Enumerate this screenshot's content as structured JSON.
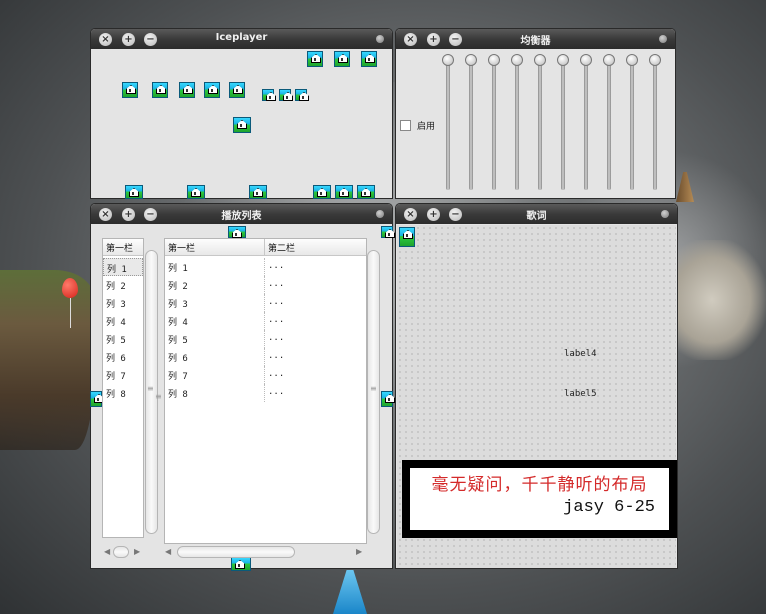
{
  "windows": {
    "player": {
      "title": "Iceplayer",
      "buttons": {
        "close": "×",
        "add": "+",
        "minimize": "−"
      }
    },
    "equalizer": {
      "title": "均衡器",
      "enable_label": "启用",
      "enabled": false,
      "band_levels": [
        1,
        1,
        1,
        1,
        1,
        1,
        1,
        1,
        1,
        1
      ]
    },
    "playlist": {
      "title": "播放列表",
      "list_panel": {
        "header": "第一栏",
        "rows": [
          "列 1",
          "列 2",
          "列 3",
          "列 4",
          "列 5",
          "列 6",
          "列 7",
          "列 8"
        ]
      },
      "song_panel": {
        "headers": [
          "第一栏",
          "第二栏"
        ],
        "rows": [
          [
            "列 1",
            "..."
          ],
          [
            "列 2",
            "..."
          ],
          [
            "列 3",
            "..."
          ],
          [
            "列 4",
            "..."
          ],
          [
            "列 5",
            "..."
          ],
          [
            "列 6",
            "..."
          ],
          [
            "列 7",
            "..."
          ],
          [
            "列 8",
            "..."
          ]
        ]
      },
      "scroll_grip": "≡"
    },
    "lyrics": {
      "title": "歌词",
      "label4": "label4",
      "label5": "label5"
    }
  },
  "note": {
    "line1": "毫无疑问，千千静听的布局",
    "line2": "jasy 6-25"
  },
  "icons": {
    "placeholder": "house-icon",
    "titlebar": [
      "close-icon",
      "add-icon",
      "minimize-icon",
      "menu-dot-icon"
    ]
  },
  "colors": {
    "titlebar": "#3a3a3a",
    "panel_bg": "#e4e4e4",
    "note_text": "#d42a2a"
  }
}
